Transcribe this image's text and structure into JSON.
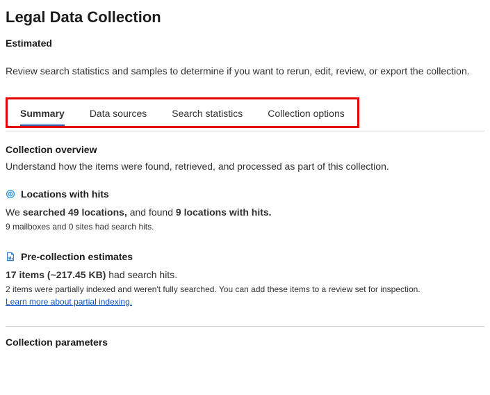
{
  "page": {
    "title": "Legal Data Collection",
    "subtitle": "Estimated",
    "description": "Review search statistics and samples to determine if you want to rerun, edit, review, or export the collection."
  },
  "tabs": [
    {
      "label": "Summary",
      "active": true
    },
    {
      "label": "Data sources",
      "active": false
    },
    {
      "label": "Search statistics",
      "active": false
    },
    {
      "label": "Collection options",
      "active": false
    }
  ],
  "overview": {
    "heading": "Collection overview",
    "text": "Understand how the items were found, retrieved, and processed as part of this collection."
  },
  "locations": {
    "heading": "Locations with hits",
    "line_prefix": "We ",
    "line_bold1": "searched 49 locations,",
    "line_mid": " and found ",
    "line_bold2": "9 locations with hits.",
    "sub": "9 mailboxes and 0 sites had search hits."
  },
  "estimates": {
    "heading": "Pre-collection estimates",
    "line_bold": "17 items (~217.45 KB)",
    "line_suffix": " had search hits.",
    "sub": "2 items were partially indexed and weren't fully searched. You can add these items to a review set for inspection.",
    "link": "Learn more about partial indexing."
  },
  "params": {
    "heading": "Collection parameters"
  }
}
